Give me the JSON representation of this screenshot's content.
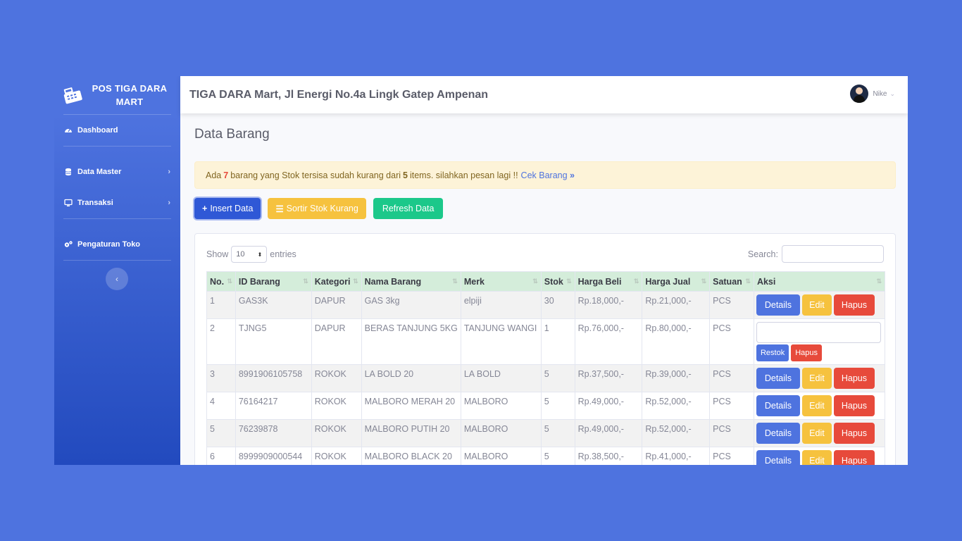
{
  "sidebar": {
    "brand": "POS TIGA DARA MART",
    "items": [
      {
        "label": "Dashboard",
        "icon": "tachometer-icon"
      },
      {
        "label": "Data Master",
        "icon": "database-icon"
      },
      {
        "label": "Transaksi",
        "icon": "desktop-icon"
      },
      {
        "label": "Pengaturan Toko",
        "icon": "gears-icon"
      }
    ]
  },
  "topbar": {
    "title": "TIGA DARA Mart, Jl Energi No.4a Lingk Gatep Ampenan",
    "user": "Nike"
  },
  "page": {
    "title": "Data Barang"
  },
  "alert": {
    "prefix": "Ada",
    "count": "7",
    "middle": "barang yang Stok tersisa sudah kurang dari",
    "threshold": "5",
    "suffix": "items. silahkan pesan lagi !!",
    "link": "Cek Barang"
  },
  "buttons": {
    "insert": "Insert Data",
    "sort": "Sortir Stok Kurang",
    "refresh": "Refresh Data"
  },
  "table": {
    "show_label": "Show",
    "entries_value": "10",
    "entries_label": "entries",
    "search_label": "Search:",
    "headers": [
      "No.",
      "ID Barang",
      "Kategori",
      "Nama Barang",
      "Merk",
      "Stok",
      "Harga Beli",
      "Harga Jual",
      "Satuan",
      "Aksi"
    ],
    "rows": [
      [
        "1",
        "GAS3K",
        "DAPUR",
        "GAS 3kg",
        "elpiji",
        "30",
        "Rp.18,000,-",
        "Rp.21,000,-",
        "PCS"
      ],
      [
        "2",
        "TJNG5",
        "DAPUR",
        "BERAS TANJUNG 5KG",
        "TANJUNG WANGI",
        "1",
        "Rp.76,000,-",
        "Rp.80,000,-",
        "PCS"
      ],
      [
        "3",
        "8991906105758",
        "ROKOK",
        "LA BOLD 20",
        "LA BOLD",
        "5",
        "Rp.37,500,-",
        "Rp.39,000,-",
        "PCS"
      ],
      [
        "4",
        "76164217",
        "ROKOK",
        "MALBORO MERAH 20",
        "MALBORO",
        "5",
        "Rp.49,000,-",
        "Rp.52,000,-",
        "PCS"
      ],
      [
        "5",
        "76239878",
        "ROKOK",
        "MALBORO PUTIH 20",
        "MALBORO",
        "5",
        "Rp.49,000,-",
        "Rp.52,000,-",
        "PCS"
      ],
      [
        "6",
        "8999909000544",
        "ROKOK",
        "MALBORO BLACK 20",
        "MALBORO",
        "5",
        "Rp.38,500,-",
        "Rp.41,000,-",
        "PCS"
      ]
    ],
    "actions": {
      "details": "Details",
      "edit": "Edit",
      "delete": "Hapus",
      "restock": "Restok"
    }
  }
}
